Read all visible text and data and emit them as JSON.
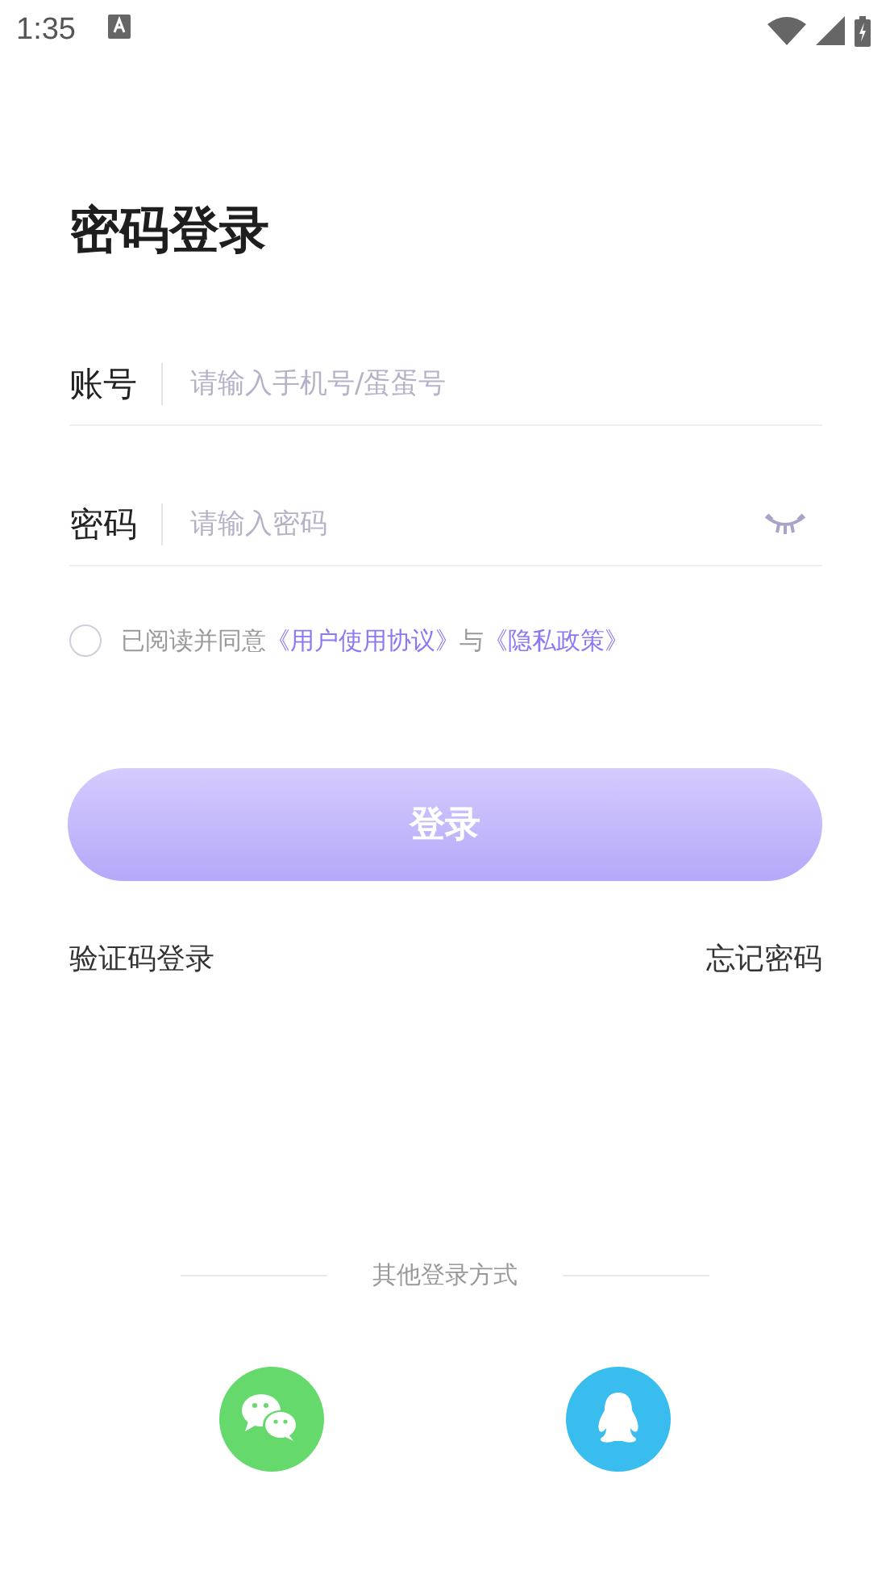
{
  "status_bar": {
    "time": "1:35"
  },
  "title": "密码登录",
  "fields": [
    {
      "kind": "text",
      "label": "账号",
      "placeholder": "请输入手机号/蛋蛋号"
    },
    {
      "kind": "password",
      "label": "密码",
      "placeholder": "请输入密码"
    }
  ],
  "agreement": {
    "checked": false,
    "parts": [
      {
        "kind": "text",
        "text": "已阅读并同意"
      },
      {
        "kind": "link",
        "text": "《用户使用协议》"
      },
      {
        "kind": "text",
        "text": "与"
      },
      {
        "kind": "link",
        "text": "《隐私政策》"
      }
    ]
  },
  "login_button": "登录",
  "links": [
    "验证码登录",
    "忘记密码"
  ],
  "other_login": {
    "label": "其他登录方式",
    "options": [
      {
        "kind": "wechat",
        "color": "#65d96c"
      },
      {
        "kind": "qq",
        "color": "#39bdef"
      }
    ]
  }
}
